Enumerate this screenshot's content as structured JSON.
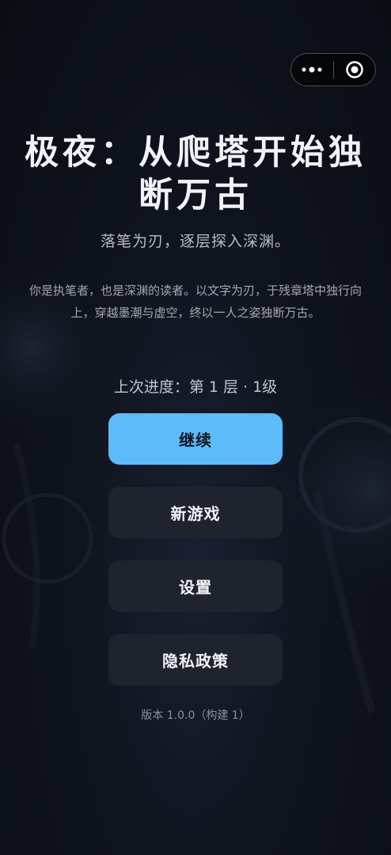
{
  "capsule": {
    "more_icon": "more-dots-icon",
    "close_icon": "target-circle-icon"
  },
  "title": "极夜：从爬塔开始独断万古",
  "subtitle": "落笔为刃，逐层探入深渊。",
  "description": "你是执笔者，也是深渊的读者。以文字为刃，于残章塔中独行向上，穿越墨潮与虚空，终以一人之姿独断万古。",
  "progress": "上次进度：第 1 层 · 1级",
  "buttons": {
    "continue": "继续",
    "new_game": "新游戏",
    "settings": "设置",
    "privacy": "隐私政策"
  },
  "version": "版本 1.0.0（构建 1）",
  "colors": {
    "primary": "#5bbcf9",
    "secondary_button": "#1f232e",
    "background": "#0f131d"
  }
}
